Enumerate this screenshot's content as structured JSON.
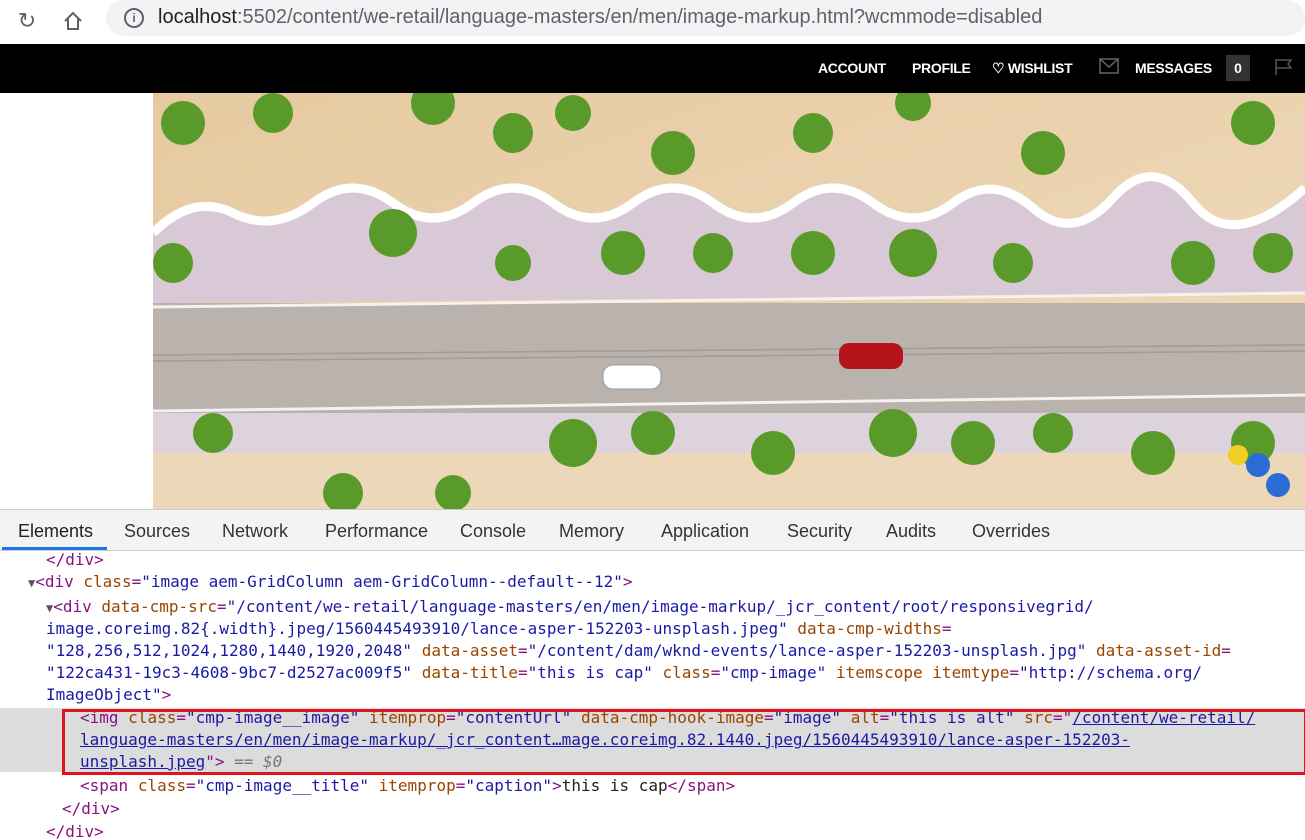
{
  "browser": {
    "url_host": "localhost",
    "url_rest": ":5502/content/we-retail/language-masters/en/men/image-markup.html?wcmmode=disabled"
  },
  "site_header": {
    "account": "ACCOUNT",
    "profile": "PROFILE",
    "wishlist": "WISHLIST",
    "messages": "MESSAGES",
    "message_count": "0"
  },
  "devtools": {
    "tabs": [
      "Elements",
      "Sources",
      "Network",
      "Performance",
      "Console",
      "Memory",
      "Application",
      "Security",
      "Audits",
      "Overrides"
    ],
    "active_tab": "Elements",
    "dom": {
      "close_div_top": "</div>",
      "div1_tag_open": "<div",
      "div1_class_attr": "class",
      "div1_class_val": "\"image aem-GridColumn aem-GridColumn--default--12\"",
      "div1_close_bracket": ">",
      "div2_tag_open": "<div",
      "div2_src_attr": "data-cmp-src",
      "div2_src_val_1": "\"/content/we-retail/language-masters/en/men/image-markup/_jcr_content/root/responsivegrid/",
      "div2_src_val_2": "image.coreimg.82{.width}.jpeg/1560445493910/lance-asper-152203-unsplash.jpeg\"",
      "div2_widths_attr": "data-cmp-widths",
      "div2_widths_val": "\"128,256,512,1024,1280,1440,1920,2048\"",
      "div2_asset_attr": "data-asset",
      "div2_asset_val": "\"/content/dam/wknd-events/lance-asper-152203-unsplash.jpg\"",
      "div2_assetid_attr": "data-asset-id",
      "div2_assetid_val": "\"122ca431-19c3-4608-9bc7-d2527ac009f5\"",
      "div2_title_attr": "data-title",
      "div2_title_val": "\"this is cap\"",
      "div2_class_attr": "class",
      "div2_class_val": "\"cmp-image\"",
      "div2_itemscope_attr": "itemscope",
      "div2_itemtype_attr": "itemtype",
      "div2_itemtype_val": "\"http://schema.org/",
      "div2_itemtype_val_2": "ImageObject\"",
      "div2_close_bracket": ">",
      "img_tag_open": "<img",
      "img_class_attr": "class",
      "img_class_val": "\"cmp-image__image\"",
      "img_itemprop_attr": "itemprop",
      "img_itemprop_val": "\"contentUrl\"",
      "img_hook_attr": "data-cmp-hook-image",
      "img_hook_val": "\"image\"",
      "img_alt_attr": "alt",
      "img_alt_val": "\"this is alt\"",
      "img_src_attr": "src",
      "img_src_link_1": "/content/we-retail/",
      "img_src_link_2": "language-masters/en/men/image-markup/_jcr_content…mage.coreimg.82.1440.jpeg/1560445493910/lance-asper-152203-",
      "img_src_link_3": "unsplash.jpeg",
      "img_close": "\">",
      "img_eq": "== $0",
      "span_tag_open": "<span",
      "span_class_attr": "class",
      "span_class_val": "\"cmp-image__title\"",
      "span_itemprop_attr": "itemprop",
      "span_itemprop_val": "\"caption\"",
      "span_text": "this is cap",
      "span_close": "</span>",
      "close_div_inner": "</div>",
      "close_div_bottom": "</div>"
    }
  }
}
